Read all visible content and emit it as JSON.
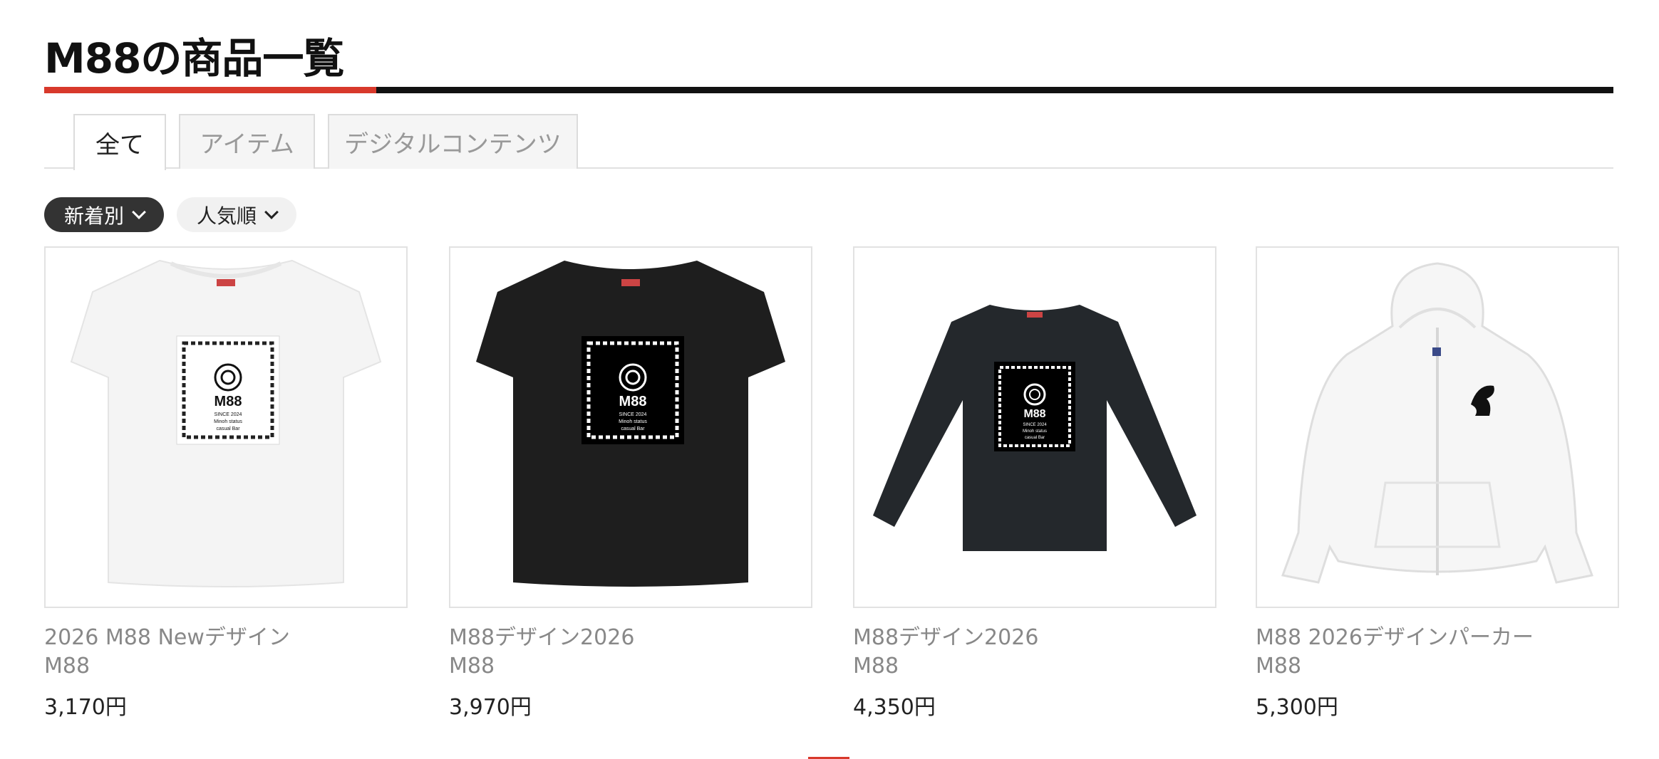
{
  "page": {
    "title": "M88の商品一覧",
    "accent_color": "#d8392b"
  },
  "tabs": [
    {
      "label": "全て",
      "active": true
    },
    {
      "label": "アイテム",
      "active": false
    },
    {
      "label": "デジタルコンテンツ",
      "active": false
    }
  ],
  "sort": [
    {
      "label": "新着別",
      "active": true,
      "icon": "chevron-down-icon"
    },
    {
      "label": "人気順",
      "active": false,
      "icon": "chevron-down-icon"
    }
  ],
  "products": [
    {
      "name": "2026 M88 Newデザイン",
      "shop": "M88",
      "price": "3,170円",
      "image": {
        "garment": "white-tshirt",
        "garment_color": "#f4f4f4",
        "print_bg": "#ffffff",
        "print_fg": "#111111",
        "print_text": [
          "M88",
          "SINCE 2024",
          "Minoh status",
          "casual Bar"
        ]
      }
    },
    {
      "name": "M88デザイン2026",
      "shop": "M88",
      "price": "3,970円",
      "image": {
        "garment": "black-tshirt",
        "garment_color": "#1e1e1e",
        "print_bg": "#000000",
        "print_fg": "#ffffff",
        "print_text": [
          "M88",
          "SINCE 2024",
          "Minoh status",
          "casual Bar"
        ]
      }
    },
    {
      "name": "M88デザイン2026",
      "shop": "M88",
      "price": "4,350円",
      "image": {
        "garment": "black-longsleeve",
        "garment_color": "#24282c",
        "print_bg": "#000000",
        "print_fg": "#ffffff",
        "print_text": [
          "M88",
          "SINCE 2024",
          "Minoh status",
          "casual Bar"
        ]
      }
    },
    {
      "name": "M88 2026デザインパーカー",
      "shop": "M88",
      "price": "5,300円",
      "image": {
        "garment": "white-zip-hoodie",
        "garment_color": "#f6f6f6",
        "logo": "horse-logo-icon"
      }
    }
  ]
}
